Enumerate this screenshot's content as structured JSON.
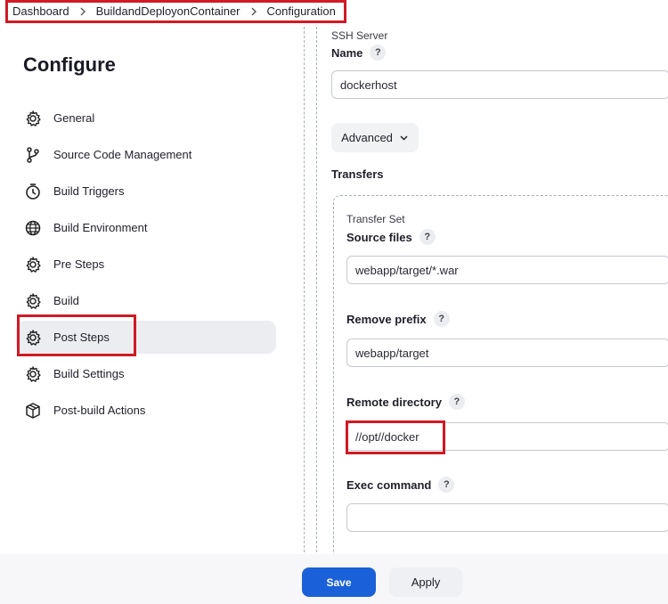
{
  "breadcrumb": {
    "items": [
      "Dashboard",
      "BuildandDeployonContainer",
      "Configuration"
    ]
  },
  "sidebar": {
    "title": "Configure",
    "items": [
      {
        "label": "General",
        "icon": "gear-icon"
      },
      {
        "label": "Source Code Management",
        "icon": "branch-icon"
      },
      {
        "label": "Build Triggers",
        "icon": "clock-icon"
      },
      {
        "label": "Build Environment",
        "icon": "globe-icon"
      },
      {
        "label": "Pre Steps",
        "icon": "gear-icon"
      },
      {
        "label": "Build",
        "icon": "gear-icon"
      },
      {
        "label": "Post Steps",
        "icon": "gear-icon",
        "active": true
      },
      {
        "label": "Build Settings",
        "icon": "gear-icon"
      },
      {
        "label": "Post-build Actions",
        "icon": "package-icon"
      }
    ]
  },
  "form": {
    "ssh_server_label": "SSH Server",
    "name_label": "Name",
    "name_value": "dockerhost",
    "advanced_label": "Advanced",
    "transfers_label": "Transfers",
    "transfer_set_label": "Transfer Set",
    "source_files_label": "Source files",
    "source_files_value": "webapp/target/*.war",
    "remove_prefix_label": "Remove prefix",
    "remove_prefix_value": "webapp/target",
    "remote_directory_label": "Remote directory",
    "remote_directory_value": "//opt//docker",
    "exec_command_label": "Exec command",
    "exec_command_value": "",
    "help_glyph": "?"
  },
  "actions": {
    "save_label": "Save",
    "apply_label": "Apply"
  },
  "colors": {
    "highlight": "#d01a25",
    "primary": "#1a60d8",
    "active_nav": "#ebedf0"
  }
}
